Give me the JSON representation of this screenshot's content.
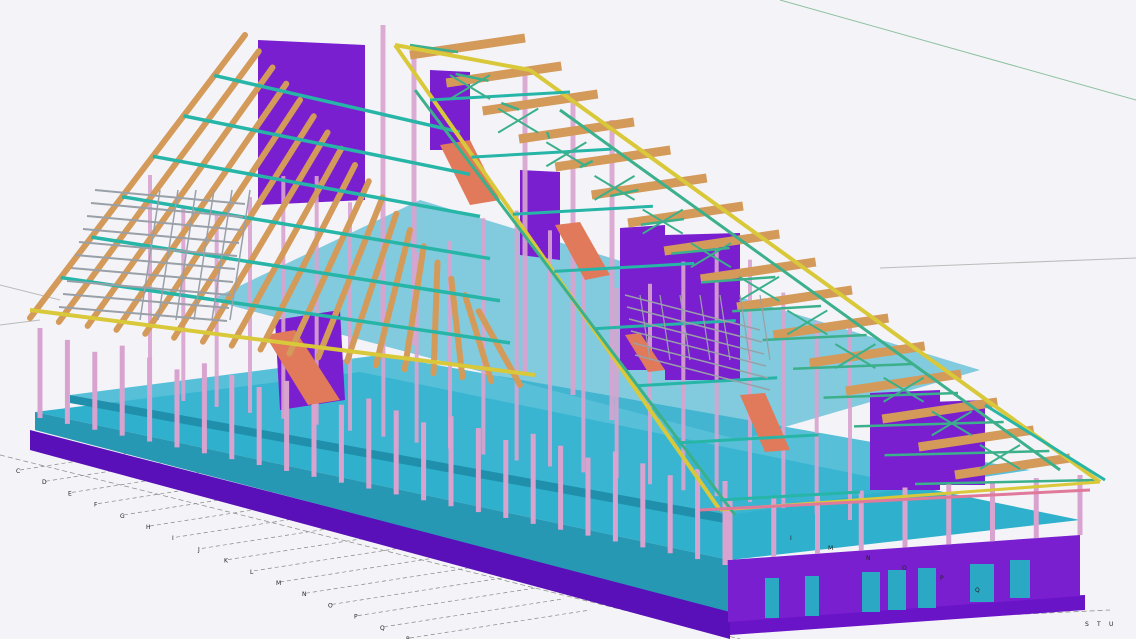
{
  "viewer": {
    "model_type": "3D BIM structural model - timber roof building",
    "background": "#f4f4f8",
    "colors": {
      "slab": "#2aa8c4",
      "wall": "#7a1fd0",
      "foundation": "#6a14c8",
      "column": "#d9a3cf",
      "rafter": "#d49a5a",
      "truss_chord": "#d8c83a",
      "truss_web": "#3bb08a",
      "purlin": "#27b5a7",
      "stair": "#e07a5a",
      "grid_line": "#888888"
    }
  },
  "grid_axes": {
    "left_labels": [
      "C",
      "D",
      "E",
      "F",
      "G",
      "H",
      "I",
      "J",
      "K",
      "L",
      "M",
      "N",
      "O",
      "P",
      "Q",
      "R"
    ],
    "bottom_labels": [
      "S",
      "T",
      "U"
    ],
    "front_labels": [
      "I",
      "M",
      "N",
      "O",
      "P",
      "Q"
    ]
  }
}
